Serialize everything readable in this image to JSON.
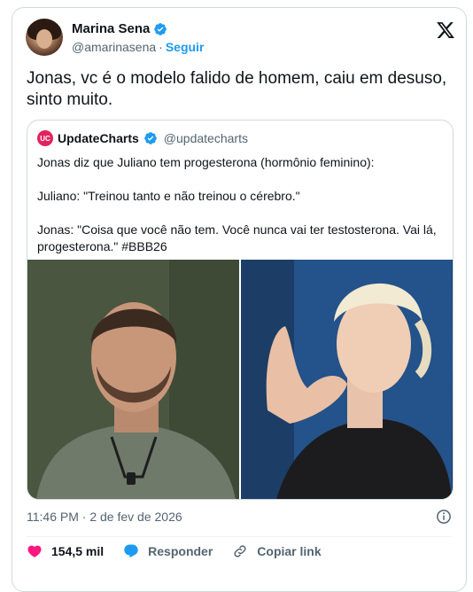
{
  "author": {
    "name": "Marina Sena",
    "handle": "@amarinasena",
    "separator": "·",
    "follow_label": "Seguir"
  },
  "tweet": {
    "text": "Jonas, vc é o modelo falido de homem, caiu em desuso, sinto muito."
  },
  "quote": {
    "avatar_text": "UC",
    "name": "UpdateCharts",
    "handle": "@updatecharts",
    "text": "Jonas diz que Juliano tem progesterona (hormônio feminino):\n\nJuliano: \"Treinou tanto e não treinou o cérebro.\"\n\nJonas: \"Coisa que você não tem. Você nunca vai ter testosterona. Vai lá, progesterona.\" #BBB26"
  },
  "meta": {
    "timestamp": "11:46 PM · 2 de fev de 2026"
  },
  "actions": {
    "likes": "154,5 mil",
    "reply_label": "Responder",
    "copy_label": "Copiar link"
  },
  "colors": {
    "accent": "#1d9bf0",
    "like": "#f91880",
    "muted": "#536471"
  },
  "icons": [
    "verified-badge-icon",
    "x-logo-icon",
    "info-icon",
    "heart-icon",
    "reply-icon",
    "link-icon"
  ]
}
